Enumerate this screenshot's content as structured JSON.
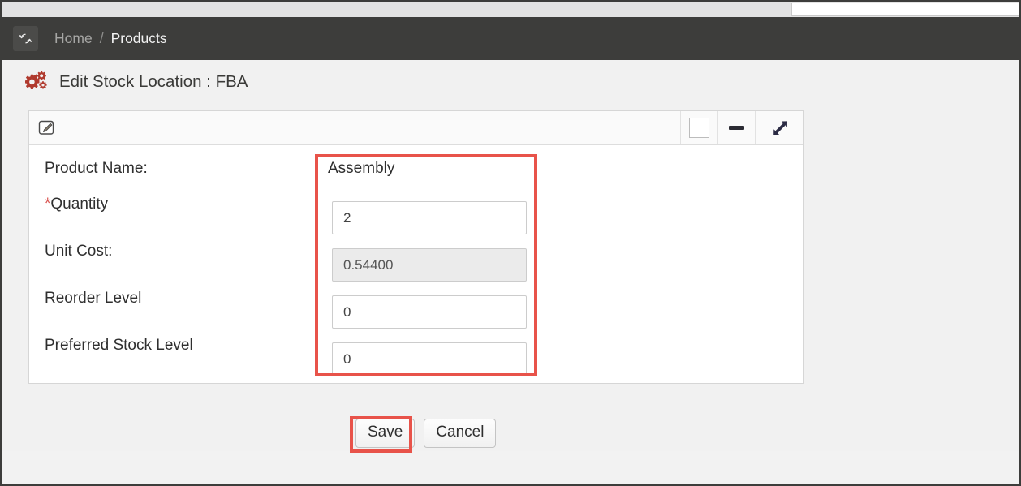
{
  "window": {
    "top_strip_field_value": ""
  },
  "breadcrumb": {
    "refresh_icon": "refresh-icon",
    "home_label": "Home",
    "separator": "/",
    "current_label": "Products"
  },
  "page": {
    "icon": "gears-icon",
    "title": "Edit Stock Location : FBA"
  },
  "panel": {
    "toolbar": {
      "edit_icon": "edit-pencil-icon",
      "restore_icon": "restore-square-icon",
      "minimize_icon": "minimize-minus-icon",
      "expand_icon": "expand-diagonal-arrows-icon"
    },
    "fields": [
      {
        "label": "Product Name:",
        "required": false,
        "type": "static",
        "value": "Assembly",
        "name": "product-name"
      },
      {
        "label": "Quantity",
        "required": true,
        "type": "input",
        "value": "2",
        "placeholder": "",
        "readonly": false,
        "name": "quantity"
      },
      {
        "label": "Unit Cost:",
        "required": false,
        "type": "input",
        "value": "0.54400",
        "placeholder": "",
        "readonly": true,
        "name": "unit-cost"
      },
      {
        "label": "Reorder Level",
        "required": false,
        "type": "input",
        "value": "0",
        "placeholder": "",
        "readonly": false,
        "name": "reorder-level"
      },
      {
        "label": "Preferred Stock Level",
        "required": false,
        "type": "input",
        "value": "0",
        "placeholder": "",
        "readonly": false,
        "name": "preferred-stock-level"
      }
    ]
  },
  "actions": {
    "save_label": "Save",
    "cancel_label": "Cancel"
  },
  "annotations": {
    "color": "#e8534a",
    "fields_highlight": "input-fields-highlight",
    "save_highlight": "save-button-highlight"
  },
  "colors": {
    "chrome_dark": "#3d3d3b",
    "page_background": "#f1f1f1",
    "panel_background": "#ffffff",
    "accent_red": "#b03a2e",
    "required_star": "#d9534f",
    "annotation_red": "#e8534a"
  }
}
